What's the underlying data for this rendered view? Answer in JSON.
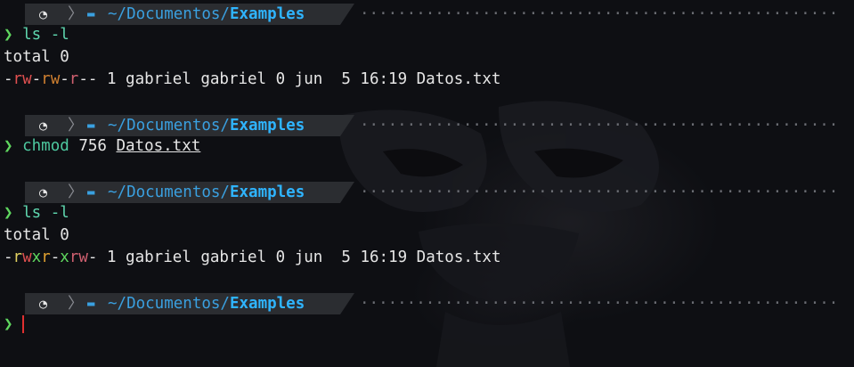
{
  "prompt": {
    "os_icon": "linux-icon",
    "separator": "〉",
    "folder_icon": "folder-icon",
    "path_prefix": "~/Documentos/",
    "path_dir": "Examples",
    "dots": "································································",
    "chevron": "❯"
  },
  "session": {
    "cmd1": "ls -l",
    "out1_total": "total 0",
    "out1_rest": " 1 gabriel gabriel 0 jun  5 16:19 Datos.txt",
    "cmd2_name": "chmod",
    "cmd2_mode": " 756 ",
    "cmd2_file": "Datos.txt",
    "cmd3": "ls -l",
    "out3_total": "total 0",
    "out3_rest": " 1 gabriel gabriel 0 jun  5 16:19 Datos.txt"
  },
  "colors": {
    "background": "#0e0f13",
    "prompt_bar": "#2b2d31",
    "path": "#3aa0e0",
    "chevron": "#5fd75f",
    "cursor": "#e03030"
  }
}
